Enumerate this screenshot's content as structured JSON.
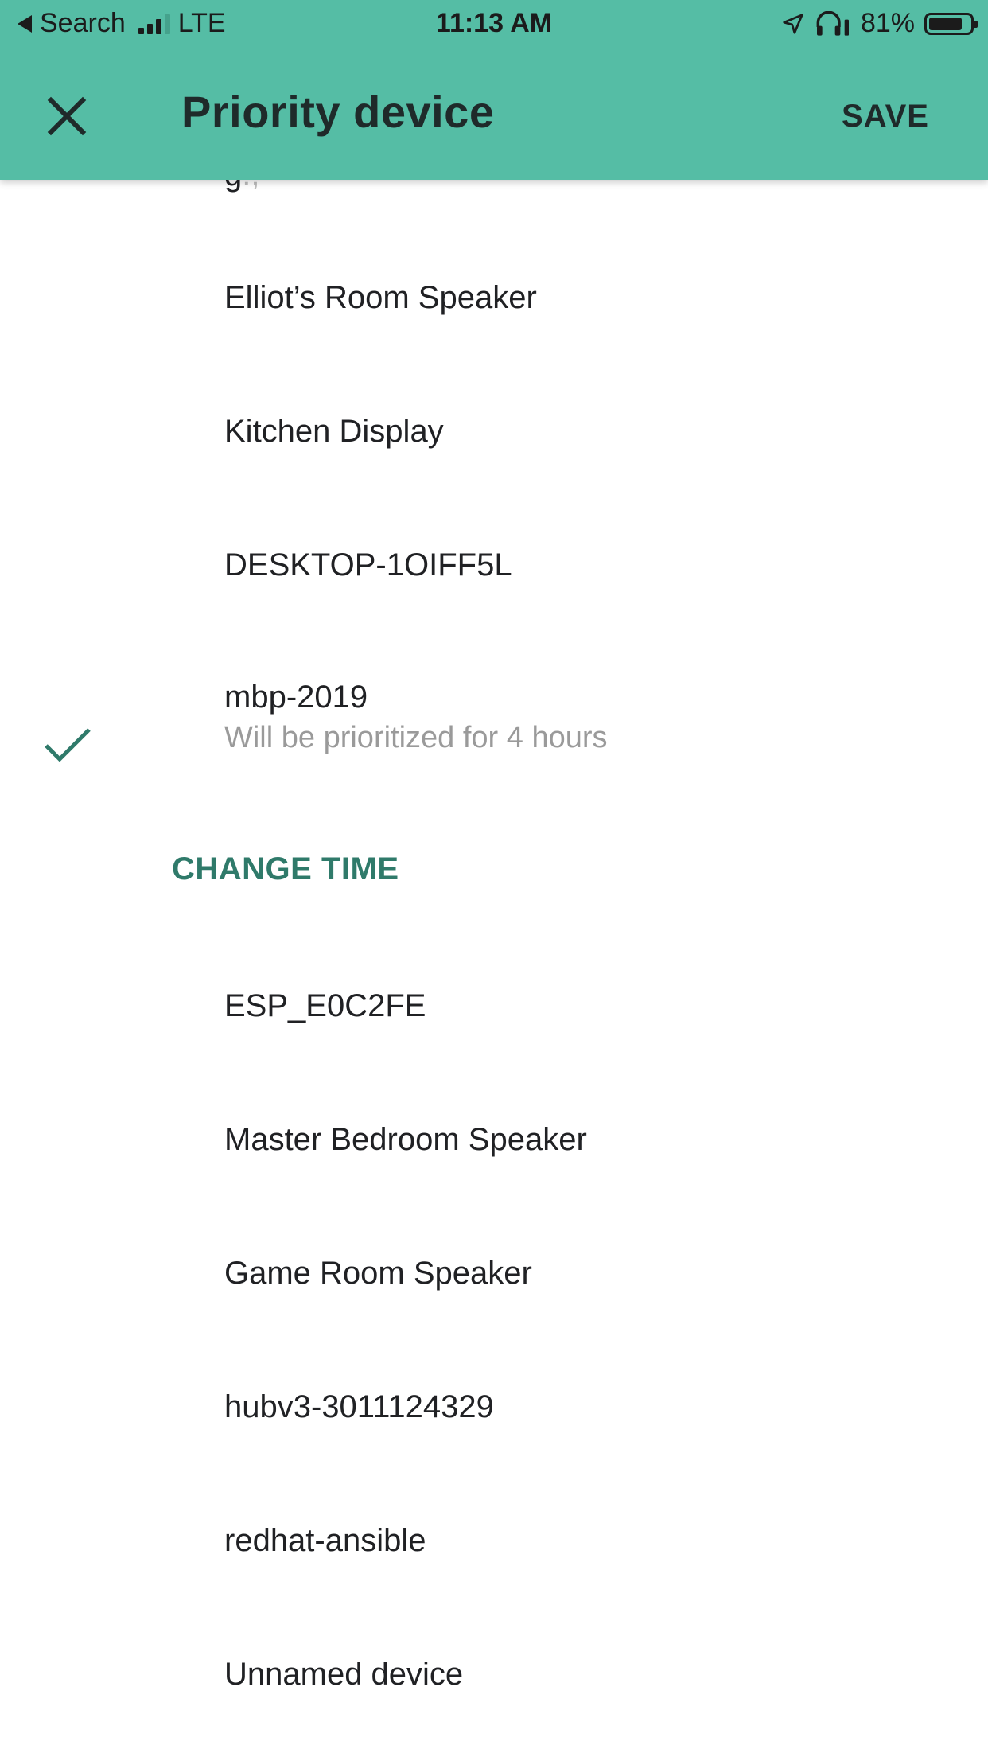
{
  "colors": {
    "accent": "#55bda5",
    "accent_dark": "#2f7a6a",
    "subtitle_gray": "#9a9a9a"
  },
  "status_bar": {
    "back_label": "Search",
    "network": "LTE",
    "time": "11:13 AM",
    "battery_percent": "81%",
    "battery_level": 0.81,
    "icons": [
      "back-arrow-icon",
      "signal-icon",
      "location-icon",
      "headphones-icon",
      "battery-icon"
    ]
  },
  "app_bar": {
    "title": "Priority device",
    "save_label": "SAVE",
    "close_icon": "close-icon"
  },
  "devices": [
    {
      "name": "Elliot’s Room Speaker"
    },
    {
      "name": "Kitchen Display"
    },
    {
      "name": "DESKTOP-1OIFF5L"
    },
    {
      "name": "mbp-2019",
      "subtitle": "Will be prioritized for 4 hours",
      "selected": true
    },
    {
      "name": "ESP_E0C2FE"
    },
    {
      "name": "Master Bedroom Speaker"
    },
    {
      "name": "Game Room Speaker"
    },
    {
      "name": "hubv3-3011124329"
    },
    {
      "name": "redhat-ansible"
    },
    {
      "name": "Unnamed device"
    }
  ],
  "change_time_label": "CHANGE TIME"
}
